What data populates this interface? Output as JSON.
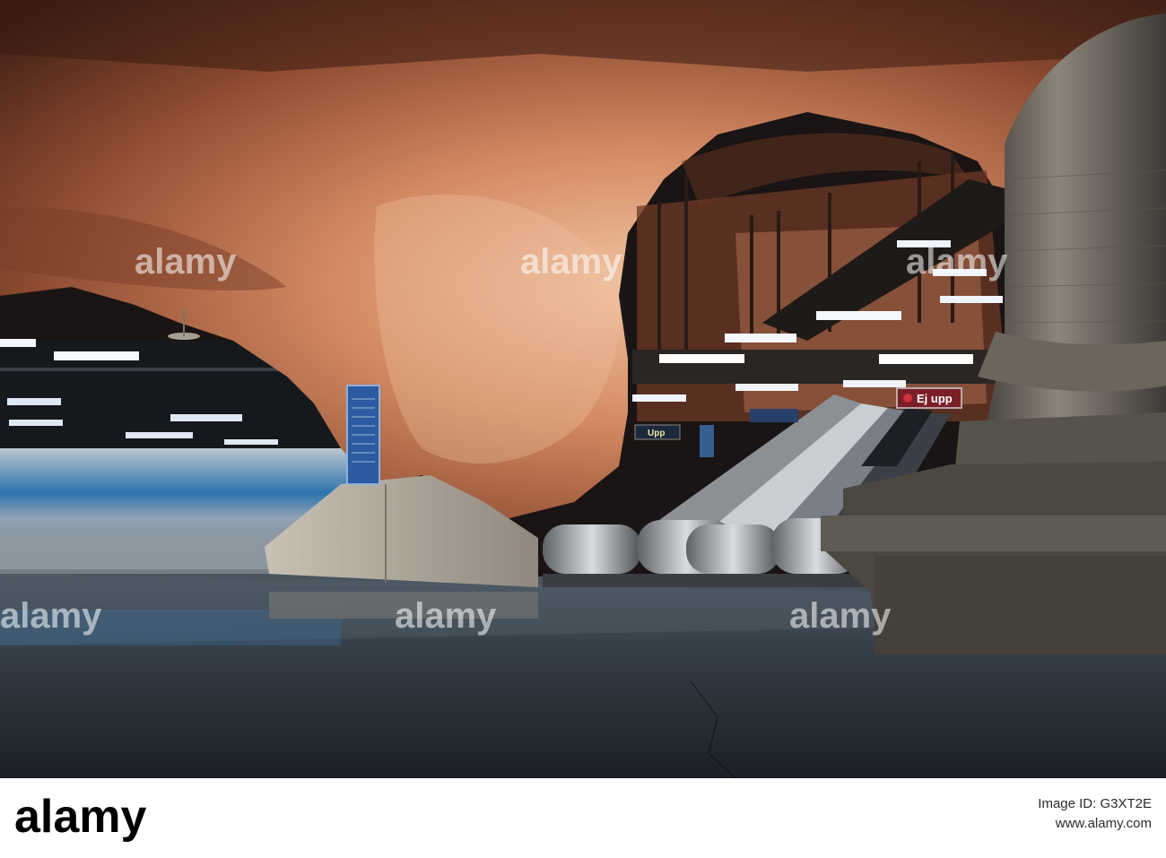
{
  "photo": {
    "signs": {
      "ej_upp": "Ej upp",
      "upp": "Upp"
    },
    "watermark": "alamy"
  },
  "footer": {
    "logo_text": "alamy",
    "image_id_label": "Image ID: G3XT2E",
    "url": "www.alamy.com"
  },
  "colors": {
    "rock_light": "#e7b08f",
    "rock_dark": "#5a2e1e",
    "floor": "#2f3942",
    "train_blue": "#2f7dc0",
    "sign_red": "#a52a32"
  }
}
